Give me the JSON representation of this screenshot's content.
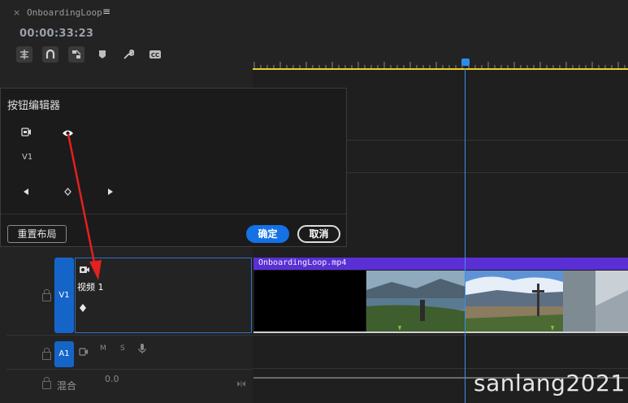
{
  "header": {
    "close_glyph": "×",
    "sequence_name": "OnboardingLoop",
    "menu_glyph": "≡",
    "timecode": "00:00:33:23"
  },
  "toolbar": {
    "tools": [
      "insert-track-icon",
      "snap-icon",
      "linked-selection-icon",
      "marker-icon",
      "wrench-icon",
      "captions-icon"
    ],
    "captions_label": "CC"
  },
  "dialog": {
    "title": "按钮编辑器",
    "track_label": "V1",
    "reset_label": "重置布局",
    "ok_label": "确定",
    "cancel_label": "取消",
    "buttons": [
      "camera-icon",
      "eye-icon",
      "prev-keyframe-icon",
      "add-keyframe-icon",
      "next-keyframe-icon"
    ]
  },
  "tracks": {
    "v1": {
      "target_label": "V1",
      "name": "视频 1"
    },
    "a1": {
      "target_label": "A1",
      "m_label": "M",
      "s_label": "S"
    },
    "mix": {
      "label": "混合",
      "value": "0.0"
    }
  },
  "clip": {
    "name": "OnboardingLoop.mp4",
    "color": "#5a2fd6"
  },
  "colors": {
    "accent": "#1472e6",
    "playhead": "#2d8ceb",
    "work_area": "#e8d22a"
  },
  "watermark": "sanlang2021"
}
